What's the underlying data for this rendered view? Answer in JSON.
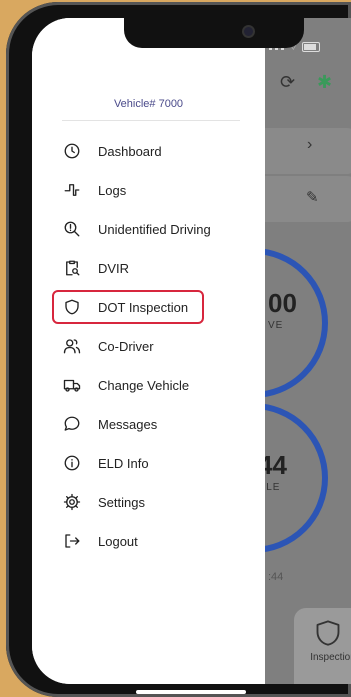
{
  "vehicle_label": "Vehicle# 7000",
  "menu": {
    "items": [
      {
        "label": "Dashboard",
        "icon": "clock-icon"
      },
      {
        "label": "Logs",
        "icon": "logs-icon"
      },
      {
        "label": "Unidentified Driving",
        "icon": "search-alert-icon"
      },
      {
        "label": "DVIR",
        "icon": "clipboard-search-icon"
      },
      {
        "label": "DOT Inspection",
        "icon": "shield-icon",
        "highlighted": true
      },
      {
        "label": "Co-Driver",
        "icon": "users-icon"
      },
      {
        "label": "Change Vehicle",
        "icon": "truck-icon"
      },
      {
        "label": "Messages",
        "icon": "message-icon"
      },
      {
        "label": "ELD Info",
        "icon": "info-icon"
      },
      {
        "label": "Settings",
        "icon": "gear-icon"
      },
      {
        "label": "Logout",
        "icon": "logout-icon"
      }
    ]
  },
  "background": {
    "ring1_value": "00",
    "ring1_label": "VE",
    "ring2_value": "44",
    "ring2_label": "CLE",
    "time_fragment": ":44",
    "bottom_tab_label": "Inspection"
  },
  "colors": {
    "highlight": "#d7263d",
    "ring": "#2c55b5",
    "backdrop": "#d9a860"
  }
}
